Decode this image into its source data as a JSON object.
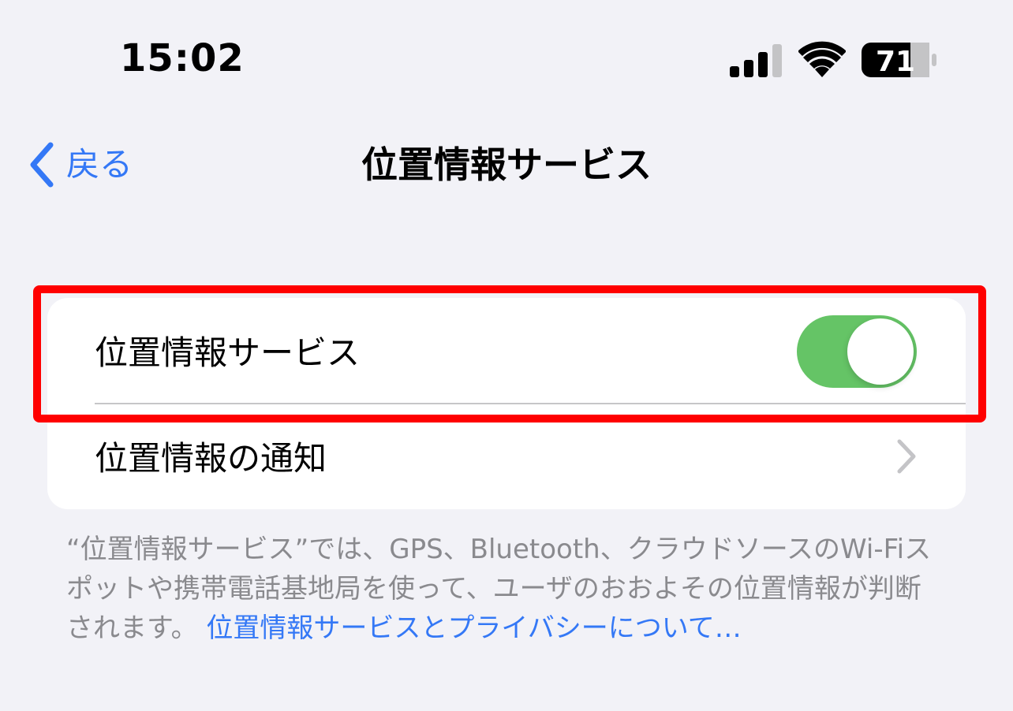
{
  "status_bar": {
    "time": "15:02",
    "battery_level": "71",
    "signal_icon": "cellular-signal-icon",
    "wifi_icon": "wifi-icon",
    "battery_icon": "battery-icon"
  },
  "nav": {
    "back_label": "戻る",
    "back_icon": "chevron-left-icon",
    "title": "位置情報サービス"
  },
  "settings": {
    "location_services": {
      "label": "位置情報サービス",
      "enabled": true
    },
    "location_alerts": {
      "label": "位置情報の通知",
      "icon": "chevron-right-icon"
    }
  },
  "footer": {
    "description": "“位置情報サービス”では、GPS、Bluetooth、クラウドソースのWi-Fiスポットや携帯電話基地局を使って、ユーザのおおよその位置情報が判断されます。",
    "link": "位置情報サービスとプライバシーについて…"
  },
  "colors": {
    "accent": "#3478f6",
    "toggle_on": "#65c466",
    "highlight": "#ff0000",
    "background": "#f2f2f7"
  }
}
